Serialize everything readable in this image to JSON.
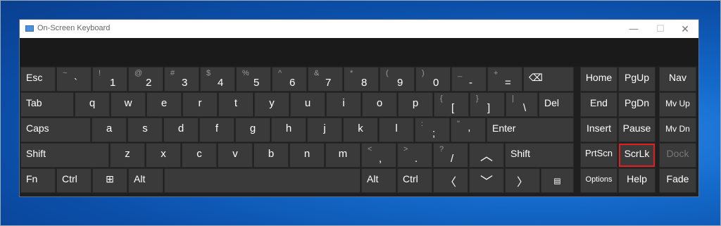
{
  "window": {
    "title": "On-Screen Keyboard",
    "minimize": "—",
    "maximize": "☐",
    "close": "✕"
  },
  "keys": {
    "esc": "Esc",
    "tilde": {
      "shift": "~",
      "main": "`"
    },
    "d1": {
      "shift": "!",
      "main": "1"
    },
    "d2": {
      "shift": "@",
      "main": "2"
    },
    "d3": {
      "shift": "#",
      "main": "3"
    },
    "d4": {
      "shift": "$",
      "main": "4"
    },
    "d5": {
      "shift": "%",
      "main": "5"
    },
    "d6": {
      "shift": "^",
      "main": "6"
    },
    "d7": {
      "shift": "&",
      "main": "7"
    },
    "d8": {
      "shift": "*",
      "main": "8"
    },
    "d9": {
      "shift": "(",
      "main": "9"
    },
    "d0": {
      "shift": ")",
      "main": "0"
    },
    "minus": {
      "shift": "_",
      "main": "-"
    },
    "equals": {
      "shift": "+",
      "main": "="
    },
    "backspace": "⌫",
    "tab": "Tab",
    "q": "q",
    "w": "w",
    "e": "e",
    "r": "r",
    "t": "t",
    "y": "y",
    "u": "u",
    "i": "i",
    "o": "o",
    "p": "p",
    "lbracket": {
      "shift": "{",
      "main": "["
    },
    "rbracket": {
      "shift": "}",
      "main": "]"
    },
    "backslash": {
      "shift": "|",
      "main": "\\"
    },
    "del": "Del",
    "caps": "Caps",
    "a": "a",
    "s": "s",
    "d": "d",
    "f": "f",
    "g": "g",
    "h": "h",
    "j": "j",
    "k": "k",
    "l": "l",
    "semicolon": {
      "shift": ":",
      "main": ";"
    },
    "quote": {
      "shift": "\"",
      "main": "'"
    },
    "enter": "Enter",
    "shift_left": "Shift",
    "z": "z",
    "x": "x",
    "c": "c",
    "v": "v",
    "b": "b",
    "n": "n",
    "m": "m",
    "comma": {
      "shift": "<",
      "main": ","
    },
    "period": {
      "shift": ">",
      "main": "."
    },
    "slash": {
      "shift": "?",
      "main": "/"
    },
    "up": "︿",
    "shift_right": "Shift",
    "fn": "Fn",
    "ctrl_left": "Ctrl",
    "win": "⊞",
    "alt_left": "Alt",
    "alt_right": "Alt",
    "ctrl_right": "Ctrl",
    "left": "〈",
    "down": "﹀",
    "right": "〉",
    "menu": "▤",
    "home": "Home",
    "pgup": "PgUp",
    "nav": "Nav",
    "end": "End",
    "pgdn": "PgDn",
    "mvup": "Mv Up",
    "insert": "Insert",
    "pause": "Pause",
    "mvdn": "Mv Dn",
    "prtscn": "PrtScn",
    "scrlk": "ScrLk",
    "dock": "Dock",
    "options": "Options",
    "help": "Help",
    "fade": "Fade"
  },
  "highlight_color": "#e02020"
}
